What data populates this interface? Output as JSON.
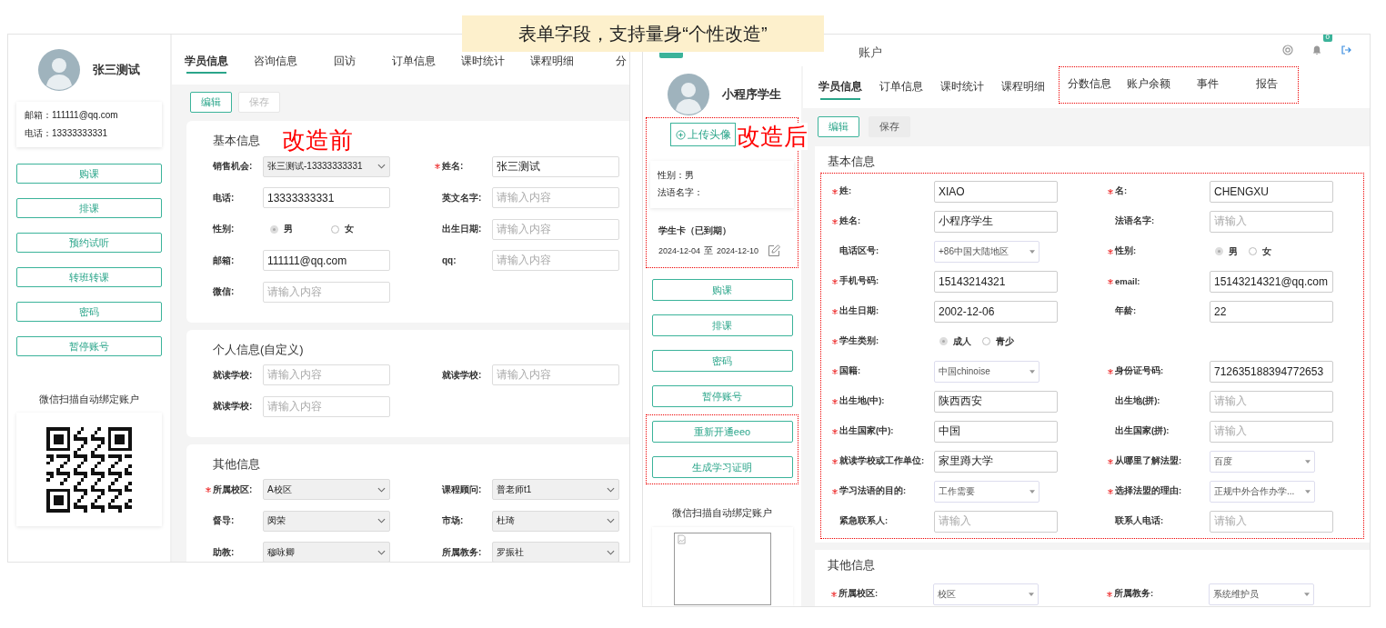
{
  "banner": {
    "text": "表单字段，支持量身“个性改造”"
  },
  "before": {
    "annotation": "改造前",
    "profile": {
      "name": "张三测试"
    },
    "contact": [
      "邮箱：111111@qq.com",
      "电话：13333333331"
    ],
    "actions": [
      {
        "label": "购课"
      },
      {
        "label": "排课"
      },
      {
        "label": "预约试听"
      },
      {
        "label": "转班转课"
      },
      {
        "label": "密码"
      },
      {
        "label": "暂停账号"
      }
    ],
    "wechat_caption": "微信扫描自动绑定账户",
    "tabs": [
      {
        "label": "学员信息",
        "selected": true
      },
      {
        "label": "咨询信息",
        "selected": false
      },
      {
        "label": "回访",
        "selected": false
      },
      {
        "label": "订单信息",
        "selected": false
      },
      {
        "label": "课时统计",
        "selected": false
      },
      {
        "label": "课程明细",
        "selected": false
      },
      {
        "label": "分",
        "selected": false
      }
    ],
    "toolbar": [
      {
        "label": "编辑",
        "disabled": false
      },
      {
        "label": "保存",
        "disabled": true
      }
    ],
    "sections": [
      {
        "title": "基本信息",
        "rows": [
          [
            {
              "label": "销售机会:",
              "required": false,
              "kind": "select",
              "value": "张三测试-13333333331"
            },
            {
              "label": "姓名:",
              "required": true,
              "kind": "input",
              "value": "张三测试"
            }
          ],
          [
            {
              "label": "电话:",
              "required": false,
              "kind": "input",
              "value": "13333333331"
            },
            {
              "label": "英文名字:",
              "required": false,
              "kind": "input",
              "placeholder": "请输入内容"
            }
          ],
          [
            {
              "label": "性别:",
              "required": false,
              "kind": "radio",
              "options": [
                {
                  "label": "男",
                  "selected": true
                },
                {
                  "label": "女",
                  "selected": false
                }
              ]
            },
            {
              "label": "出生日期:",
              "required": false,
              "kind": "input",
              "placeholder": "请输入内容"
            }
          ],
          [
            {
              "label": "邮箱:",
              "required": false,
              "kind": "input",
              "value": "111111@qq.com"
            },
            {
              "label": "qq:",
              "required": false,
              "kind": "input",
              "placeholder": "请输入内容"
            }
          ],
          [
            {
              "label": "微信:",
              "required": false,
              "kind": "input",
              "placeholder": "请输入内容"
            }
          ]
        ]
      },
      {
        "title": "个人信息(自定义)",
        "rows": [
          [
            {
              "label": "就读学校:",
              "required": false,
              "kind": "input",
              "placeholder": "请输入内容"
            },
            {
              "label": "就读学校:",
              "required": false,
              "kind": "input",
              "placeholder": "请输入内容"
            }
          ],
          [
            {
              "label": "就读学校:",
              "required": false,
              "kind": "input",
              "placeholder": "请输入内容"
            }
          ]
        ]
      },
      {
        "title": "其他信息",
        "rows": [
          [
            {
              "label": "所属校区:",
              "required": true,
              "kind": "select",
              "value": "A校区"
            },
            {
              "label": "课程顾问:",
              "required": false,
              "kind": "select",
              "value": "普老师t1"
            }
          ],
          [
            {
              "label": "督导:",
              "required": false,
              "kind": "select",
              "value": "闵荣"
            },
            {
              "label": "市场:",
              "required": false,
              "kind": "select",
              "value": "杜琦"
            }
          ],
          [
            {
              "label": "助教:",
              "required": false,
              "kind": "select",
              "value": "穆咏卿"
            },
            {
              "label": "所属教务:",
              "required": false,
              "kind": "select",
              "value": "罗振社"
            }
          ]
        ]
      }
    ]
  },
  "after": {
    "annotation": "改造后",
    "top_nav": [
      {
        "label": "账户",
        "selected": false
      }
    ],
    "notification_badge": "0",
    "profile": {
      "name": "小程序学生"
    },
    "upload_button": "上传头像",
    "info": [
      "性别：男",
      "法语名字："
    ],
    "student_card": {
      "title": "学生卡（已到期）",
      "start": "2024-12-04",
      "separator": "至",
      "end": "2024-12-10"
    },
    "actions": [
      {
        "label": "购课"
      },
      {
        "label": "排课"
      },
      {
        "label": "密码"
      },
      {
        "label": "暂停账号"
      }
    ],
    "added_actions": [
      {
        "label": "重新开通eeo"
      },
      {
        "label": "生成学习证明"
      }
    ],
    "wechat_caption": "微信扫描自动绑定账户",
    "tabs": [
      {
        "label": "学员信息",
        "selected": true
      },
      {
        "label": "订单信息",
        "selected": false
      },
      {
        "label": "课时统计",
        "selected": false
      },
      {
        "label": "课程明细",
        "selected": false
      }
    ],
    "added_tabs": [
      {
        "label": "分数信息",
        "selected": false
      },
      {
        "label": "账户余额",
        "selected": false
      },
      {
        "label": "事件",
        "selected": false
      },
      {
        "label": "报告",
        "selected": false
      }
    ],
    "toolbar": [
      {
        "label": "编辑",
        "disabled": false
      },
      {
        "label": "保存",
        "disabled": true
      }
    ],
    "sections": [
      {
        "title": "基本信息",
        "rows": [
          [
            {
              "label": "姓:",
              "required": true,
              "kind": "input",
              "value": "XIAO"
            },
            {
              "label": "名:",
              "required": true,
              "kind": "input",
              "value": "CHENGXU"
            }
          ],
          [
            {
              "label": "姓名:",
              "required": true,
              "kind": "input",
              "value": "小程序学生"
            },
            {
              "label": "法语名字:",
              "required": false,
              "kind": "input",
              "placeholder": "请输入"
            }
          ],
          [
            {
              "label": "电话区号:",
              "required": false,
              "kind": "select",
              "value": "+86中国大陆地区"
            },
            {
              "label": "性别:",
              "required": true,
              "kind": "radio",
              "options": [
                {
                  "label": "男",
                  "selected": true
                },
                {
                  "label": "女",
                  "selected": false
                }
              ]
            }
          ],
          [
            {
              "label": "手机号码:",
              "required": true,
              "kind": "input",
              "value": "15143214321"
            },
            {
              "label": "email:",
              "required": true,
              "kind": "input",
              "value": "15143214321@qq.com"
            }
          ],
          [
            {
              "label": "出生日期:",
              "required": true,
              "kind": "input",
              "value": "2002-12-06"
            },
            {
              "label": "年龄:",
              "required": false,
              "kind": "input",
              "value": "22"
            }
          ],
          [
            {
              "label": "学生类别:",
              "required": true,
              "kind": "radio",
              "options": [
                {
                  "label": "成人",
                  "selected": true
                },
                {
                  "label": "青少",
                  "selected": false
                }
              ]
            }
          ],
          [
            {
              "label": "国籍:",
              "required": true,
              "kind": "select",
              "value": "中国chinoise"
            },
            {
              "label": "身份证号码:",
              "required": true,
              "kind": "input",
              "value": "712635188394772653"
            }
          ],
          [
            {
              "label": "出生地(中):",
              "required": true,
              "kind": "input",
              "value": "陕西西安"
            },
            {
              "label": "出生地(拼):",
              "required": false,
              "kind": "input",
              "placeholder": "请输入"
            }
          ],
          [
            {
              "label": "出生国家(中):",
              "required": true,
              "kind": "input",
              "value": "中国"
            },
            {
              "label": "出生国家(拼):",
              "required": false,
              "kind": "input",
              "placeholder": "请输入"
            }
          ],
          [
            {
              "label": "就读学校或工作单位:",
              "required": true,
              "kind": "input",
              "value": "家里蹲大学"
            },
            {
              "label": "从哪里了解法盟:",
              "required": true,
              "kind": "select",
              "value": "百度"
            }
          ],
          [
            {
              "label": "学习法语的目的:",
              "required": true,
              "kind": "select",
              "value": "工作需要"
            },
            {
              "label": "选择法盟的理由:",
              "required": true,
              "kind": "select",
              "value": "正规中外合作办学..."
            }
          ],
          [
            {
              "label": "紧急联系人:",
              "required": false,
              "kind": "input",
              "placeholder": "请输入"
            },
            {
              "label": "联系人电话:",
              "required": false,
              "kind": "input",
              "placeholder": "请输入"
            }
          ]
        ]
      },
      {
        "title": "其他信息",
        "rows": [
          [
            {
              "label": "所属校区:",
              "required": true,
              "kind": "select",
              "value": "校区"
            },
            {
              "label": "所属教务:",
              "required": true,
              "kind": "select",
              "value": "系统维护员"
            }
          ]
        ]
      }
    ]
  }
}
